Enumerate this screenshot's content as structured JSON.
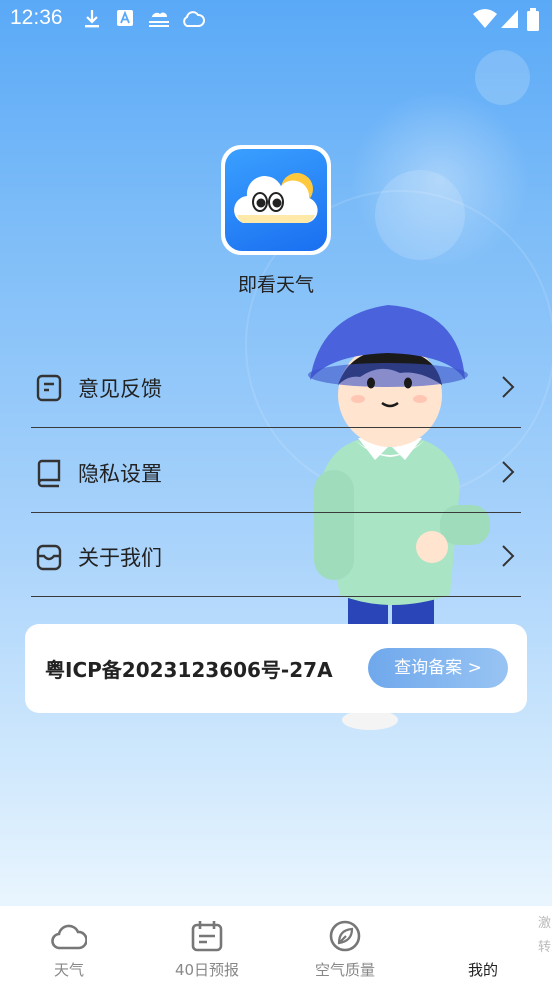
{
  "status_bar": {
    "time": "12:36",
    "icons": [
      "download-icon",
      "app-a-icon",
      "fog-icon",
      "cloud-icon"
    ],
    "right_icons": [
      "wifi-icon",
      "signal-icon",
      "battery-icon"
    ]
  },
  "app": {
    "name": "即看天气",
    "logo": "cloud-face-logo"
  },
  "menu": {
    "items": [
      {
        "label": "意见反馈",
        "icon": "feedback-icon"
      },
      {
        "label": "隐私设置",
        "icon": "privacy-book-icon"
      },
      {
        "label": "关于我们",
        "icon": "about-box-icon"
      }
    ]
  },
  "icp": {
    "text": "粤ICP备2023123606号-27A",
    "button_label": "查询备案 >"
  },
  "tabbar": {
    "tabs": [
      {
        "label": "天气",
        "icon": "cloud-icon"
      },
      {
        "label": "40日预报",
        "icon": "calendar-icon"
      },
      {
        "label": "空气质量",
        "icon": "leaf-icon"
      },
      {
        "label": "我的",
        "icon": "none",
        "active": true
      }
    ],
    "edge_text": [
      "激",
      "转"
    ]
  },
  "colors": {
    "accent": "#6fa8ec",
    "background_top": "#5aa9f7",
    "background_bottom": "#e9f5fe"
  }
}
